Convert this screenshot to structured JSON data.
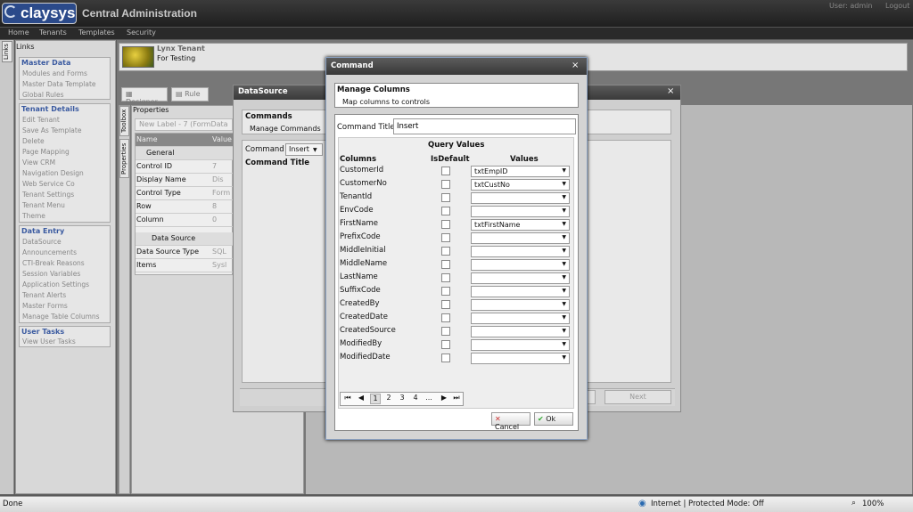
{
  "header": {
    "logo": "claysys",
    "title": "Central Administration",
    "user": "User: admin",
    "logout": "Logout"
  },
  "nav": [
    "Home",
    "Tenants",
    "Templates",
    "Security"
  ],
  "left_tab": "Links",
  "links": {
    "heading": "Links",
    "groups": [
      {
        "title": "Master Data",
        "items": [
          "Modules and Forms",
          "Master Data Template",
          "Global Rules"
        ]
      },
      {
        "title": "Tenant Details",
        "items": [
          "Edit Tenant",
          "Save As Template",
          "Delete",
          "Page Mapping",
          "View CRM",
          "Navigation Design",
          "Web Service Co",
          "Tenant Settings",
          "Tenant Menu",
          "Theme"
        ]
      },
      {
        "title": "Data Entry",
        "items": [
          "DataSource",
          "Announcements",
          "CTI-Break Reasons",
          "Session Variables",
          "Application Settings",
          "Tenant Alerts",
          "Master Forms",
          "Manage Table Columns"
        ]
      },
      {
        "title": "User Tasks",
        "items": [
          "View User Tasks"
        ]
      }
    ]
  },
  "tenant": {
    "name": "Lynx Tenant",
    "subtitle": "For Testing"
  },
  "toolbar": {
    "designer": "Designer",
    "rule": "Rule"
  },
  "side_tabs": {
    "toolbox": "Toolbox",
    "properties": "Properties"
  },
  "properties": {
    "heading": "Properties",
    "selected": "New Label - 7 (FormData",
    "col_name": "Name",
    "col_value": "Value",
    "rows": [
      {
        "type": "group",
        "name": "General"
      },
      {
        "name": "Control ID",
        "value": "7"
      },
      {
        "name": "Display Name",
        "value": "Dis"
      },
      {
        "name": "Control Type",
        "value": "Form"
      },
      {
        "name": "Row",
        "value": "8"
      },
      {
        "name": "Column",
        "value": "0"
      },
      {
        "type": "group",
        "name": "Data Source"
      },
      {
        "name": "Data Source Type",
        "value": "SQL"
      },
      {
        "name": "Items",
        "value": "Sysl"
      }
    ]
  },
  "datasource_dialog": {
    "title": "DataSource",
    "commands_title": "Commands",
    "commands_sub": "Manage Commands",
    "command_label": "Command",
    "command_value": "Insert",
    "command_title_label": "Command Title",
    "next": "Next"
  },
  "command_dialog": {
    "title": "Command",
    "manage_title": "Manage Columns",
    "manage_sub": "Map columns to controls",
    "command_title_label": "Command Title",
    "command_title_value": "Insert",
    "query_values": "Query Values",
    "col_columns": "Columns",
    "col_isdefault": "IsDefault",
    "col_values": "Values",
    "rows": [
      {
        "column": "CustomerId",
        "value": "txtEmpID"
      },
      {
        "column": "CustomerNo",
        "value": "txtCustNo"
      },
      {
        "column": "TenantId",
        "value": ""
      },
      {
        "column": "EnvCode",
        "value": ""
      },
      {
        "column": "FirstName",
        "value": "txtFirstName"
      },
      {
        "column": "PrefixCode",
        "value": ""
      },
      {
        "column": "MiddleInitial",
        "value": ""
      },
      {
        "column": "MiddleName",
        "value": ""
      },
      {
        "column": "LastName",
        "value": ""
      },
      {
        "column": "SuffixCode",
        "value": ""
      },
      {
        "column": "CreatedBy",
        "value": ""
      },
      {
        "column": "CreatedDate",
        "value": ""
      },
      {
        "column": "CreatedSource",
        "value": ""
      },
      {
        "column": "ModifiedBy",
        "value": ""
      },
      {
        "column": "ModifiedDate",
        "value": ""
      }
    ],
    "pager": {
      "first": "⏮",
      "prev": "◀",
      "pages": [
        "1",
        "2",
        "3",
        "4",
        "..."
      ],
      "next": "▶",
      "last": "⏭"
    },
    "cancel": "Cancel",
    "ok": "Ok"
  },
  "status": {
    "left": "Done",
    "zone": "Internet | Protected Mode: Off",
    "zoom": "100%"
  }
}
